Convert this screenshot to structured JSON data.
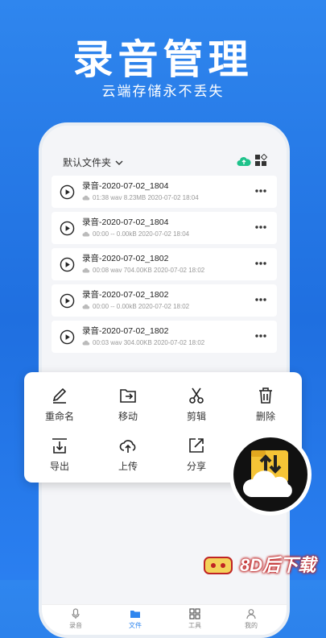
{
  "hero": {
    "title": "录音管理",
    "subtitle": "云端存储永不丢失"
  },
  "phone": {
    "folder_label": "默认文件夹",
    "recordings": [
      {
        "name": "录音-2020-07-02_1804",
        "meta": "01:38  wav  8.23MB  2020-07-02 18:04"
      },
      {
        "name": "录音-2020-07-02_1804",
        "meta": "00:00  --  0.00kB  2020-07-02 18:04"
      },
      {
        "name": "录音-2020-07-02_1802",
        "meta": "00:08  wav  704.00KB  2020-07-02 18:02"
      },
      {
        "name": "录音-2020-07-02_1802",
        "meta": "00:00  --  0.00kB  2020-07-02 18:02"
      },
      {
        "name": "录音-2020-07-02_1802",
        "meta": "00:03  wav  304.00KB  2020-07-02 18:02"
      }
    ],
    "tabs": [
      {
        "label": "录音",
        "icon": "mic-icon"
      },
      {
        "label": "文件",
        "icon": "folder-icon"
      },
      {
        "label": "工具",
        "icon": "tools-icon"
      },
      {
        "label": "我的",
        "icon": "profile-icon"
      }
    ]
  },
  "actions": {
    "rename": "重命名",
    "move": "移动",
    "clip": "剪辑",
    "delete": "删除",
    "export": "导出",
    "upload": "上传",
    "share": "分享"
  },
  "watermark": {
    "text": "8D后下载"
  },
  "colors": {
    "brand": "#2f86ee",
    "cloud_green": "#1ec28b",
    "badge_bg": "#111111",
    "folder_yellow": "#f5c436"
  }
}
